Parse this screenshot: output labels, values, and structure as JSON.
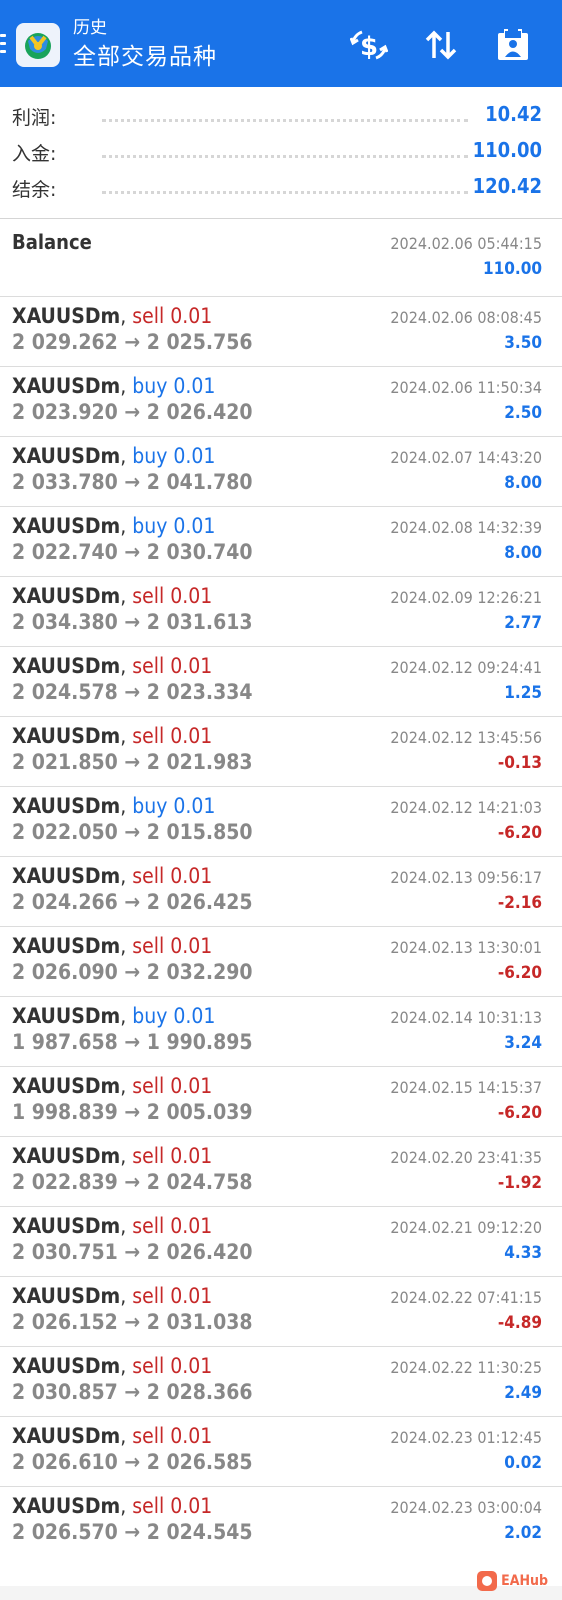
{
  "header": {
    "subtitle": "历史",
    "title": "全部交易品种",
    "icons": [
      "menu-icon",
      "app-logo",
      "currency-exchange-icon",
      "sort-icon",
      "calendar-icon"
    ]
  },
  "summary": [
    {
      "label": "利润:",
      "value": "10.42"
    },
    {
      "label": "入金:",
      "value": "110.00"
    },
    {
      "label": "结余:",
      "value": "120.42"
    }
  ],
  "balance": {
    "label": "Balance",
    "time": "2024.02.06 05:44:15",
    "amount": "110.00"
  },
  "deals": [
    {
      "symbol": "XAUUSDm",
      "side": "sell",
      "volume": "0.01",
      "open": "2 029.262",
      "close": "2 025.756",
      "time": "2024.02.06 08:08:45",
      "profit": "3.50"
    },
    {
      "symbol": "XAUUSDm",
      "side": "buy",
      "volume": "0.01",
      "open": "2 023.920",
      "close": "2 026.420",
      "time": "2024.02.06 11:50:34",
      "profit": "2.50"
    },
    {
      "symbol": "XAUUSDm",
      "side": "buy",
      "volume": "0.01",
      "open": "2 033.780",
      "close": "2 041.780",
      "time": "2024.02.07 14:43:20",
      "profit": "8.00"
    },
    {
      "symbol": "XAUUSDm",
      "side": "buy",
      "volume": "0.01",
      "open": "2 022.740",
      "close": "2 030.740",
      "time": "2024.02.08 14:32:39",
      "profit": "8.00"
    },
    {
      "symbol": "XAUUSDm",
      "side": "sell",
      "volume": "0.01",
      "open": "2 034.380",
      "close": "2 031.613",
      "time": "2024.02.09 12:26:21",
      "profit": "2.77"
    },
    {
      "symbol": "XAUUSDm",
      "side": "sell",
      "volume": "0.01",
      "open": "2 024.578",
      "close": "2 023.334",
      "time": "2024.02.12 09:24:41",
      "profit": "1.25"
    },
    {
      "symbol": "XAUUSDm",
      "side": "sell",
      "volume": "0.01",
      "open": "2 021.850",
      "close": "2 021.983",
      "time": "2024.02.12 13:45:56",
      "profit": "-0.13"
    },
    {
      "symbol": "XAUUSDm",
      "side": "buy",
      "volume": "0.01",
      "open": "2 022.050",
      "close": "2 015.850",
      "time": "2024.02.12 14:21:03",
      "profit": "-6.20"
    },
    {
      "symbol": "XAUUSDm",
      "side": "sell",
      "volume": "0.01",
      "open": "2 024.266",
      "close": "2 026.425",
      "time": "2024.02.13 09:56:17",
      "profit": "-2.16"
    },
    {
      "symbol": "XAUUSDm",
      "side": "sell",
      "volume": "0.01",
      "open": "2 026.090",
      "close": "2 032.290",
      "time": "2024.02.13 13:30:01",
      "profit": "-6.20"
    },
    {
      "symbol": "XAUUSDm",
      "side": "buy",
      "volume": "0.01",
      "open": "1 987.658",
      "close": "1 990.895",
      "time": "2024.02.14 10:31:13",
      "profit": "3.24"
    },
    {
      "symbol": "XAUUSDm",
      "side": "sell",
      "volume": "0.01",
      "open": "1 998.839",
      "close": "2 005.039",
      "time": "2024.02.15 14:15:37",
      "profit": "-6.20"
    },
    {
      "symbol": "XAUUSDm",
      "side": "sell",
      "volume": "0.01",
      "open": "2 022.839",
      "close": "2 024.758",
      "time": "2024.02.20 23:41:35",
      "profit": "-1.92"
    },
    {
      "symbol": "XAUUSDm",
      "side": "sell",
      "volume": "0.01",
      "open": "2 030.751",
      "close": "2 026.420",
      "time": "2024.02.21 09:12:20",
      "profit": "4.33"
    },
    {
      "symbol": "XAUUSDm",
      "side": "sell",
      "volume": "0.01",
      "open": "2 026.152",
      "close": "2 031.038",
      "time": "2024.02.22 07:41:15",
      "profit": "-4.89"
    },
    {
      "symbol": "XAUUSDm",
      "side": "sell",
      "volume": "0.01",
      "open": "2 030.857",
      "close": "2 028.366",
      "time": "2024.02.22 11:30:25",
      "profit": "2.49"
    },
    {
      "symbol": "XAUUSDm",
      "side": "sell",
      "volume": "0.01",
      "open": "2 026.610",
      "close": "2 026.585",
      "time": "2024.02.23 01:12:45",
      "profit": "0.02"
    },
    {
      "symbol": "XAUUSDm",
      "side": "sell",
      "volume": "0.01",
      "open": "2 026.570",
      "close": "2 024.545",
      "time": "2024.02.23 03:00:04",
      "profit": "2.02"
    }
  ],
  "watermark": "EAHub",
  "colors": {
    "primary": "#1a73e8",
    "sell": "#c62828",
    "buy": "#1a73e8",
    "negative": "#c62828",
    "positive": "#1a73e8",
    "muted": "#888888"
  }
}
